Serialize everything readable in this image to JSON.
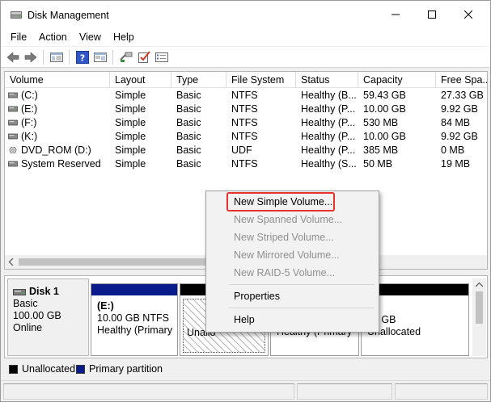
{
  "window": {
    "title": "Disk Management"
  },
  "menu": [
    "File",
    "Action",
    "View",
    "Help"
  ],
  "table": {
    "columns": [
      "Volume",
      "Layout",
      "Type",
      "File System",
      "Status",
      "Capacity",
      "Free Spa..."
    ],
    "rows": [
      {
        "volume": "(C:)",
        "layout": "Simple",
        "type": "Basic",
        "fs": "NTFS",
        "status": "Healthy (B...",
        "capacity": "59.43 GB",
        "free": "27.33 GB",
        "icon": "drive-icon"
      },
      {
        "volume": "(E:)",
        "layout": "Simple",
        "type": "Basic",
        "fs": "NTFS",
        "status": "Healthy (P...",
        "capacity": "10.00 GB",
        "free": "9.92 GB",
        "icon": "drive-icon"
      },
      {
        "volume": "(F:)",
        "layout": "Simple",
        "type": "Basic",
        "fs": "NTFS",
        "status": "Healthy (P...",
        "capacity": "530 MB",
        "free": "84 MB",
        "icon": "drive-icon"
      },
      {
        "volume": "(K:)",
        "layout": "Simple",
        "type": "Basic",
        "fs": "NTFS",
        "status": "Healthy (P...",
        "capacity": "10.00 GB",
        "free": "9.92 GB",
        "icon": "drive-icon"
      },
      {
        "volume": "DVD_ROM (D:)",
        "layout": "Simple",
        "type": "Basic",
        "fs": "UDF",
        "status": "Healthy (P...",
        "capacity": "385 MB",
        "free": "0 MB",
        "icon": "dvd-icon"
      },
      {
        "volume": "System Reserved",
        "layout": "Simple",
        "type": "Basic",
        "fs": "NTFS",
        "status": "Healthy (S...",
        "capacity": "50 MB",
        "free": "19 MB",
        "icon": "drive-icon"
      }
    ]
  },
  "disk": {
    "name": "Disk 1",
    "type": "Basic",
    "size": "100.00 GB",
    "state": "Online",
    "partitions": [
      {
        "name": "(E:)",
        "detail": "10.00 GB NTFS",
        "status": "Healthy (Primary P",
        "kind": "primary"
      },
      {
        "name": "",
        "detail": "",
        "status": "Unallo",
        "kind": "unallocated-selected"
      },
      {
        "name": "",
        "detail": "",
        "status": "Healthy (Primary",
        "kind": "primary-partial"
      },
      {
        "name": "",
        "detail": "00 GB",
        "status": "Unallocated",
        "kind": "unallocated"
      }
    ]
  },
  "legend": [
    {
      "label": "Unallocated",
      "color": "#000000"
    },
    {
      "label": "Primary partition",
      "color": "#0a1c8c"
    }
  ],
  "context_menu": {
    "items": [
      {
        "label": "New Simple Volume...",
        "enabled": true,
        "highlighted": true
      },
      {
        "label": "New Spanned Volume...",
        "enabled": false
      },
      {
        "label": "New Striped Volume...",
        "enabled": false
      },
      {
        "label": "New Mirrored Volume...",
        "enabled": false
      },
      {
        "label": "New RAID-5 Volume...",
        "enabled": false
      },
      {
        "label": "Properties",
        "enabled": true
      },
      {
        "label": "Help",
        "enabled": true
      }
    ]
  },
  "colors": {
    "primary_bar": "#0a1c8c",
    "unallocated_bar": "#000000",
    "highlight_outline": "#e8322d"
  }
}
